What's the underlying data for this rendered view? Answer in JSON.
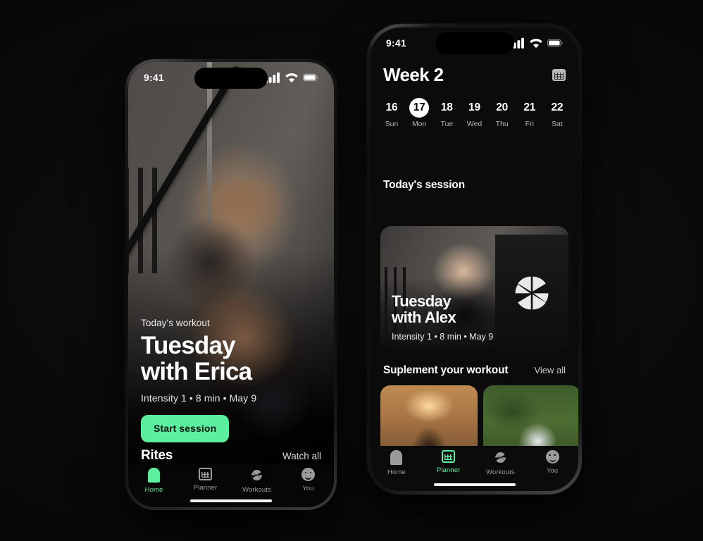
{
  "background_color": "#0a0a0a",
  "accent_color": "#5CEFA0",
  "phone_left": {
    "name": "home-screen",
    "status_bar": {
      "time": "9:41",
      "cellular": "signal-icon",
      "wifi": "wifi-icon",
      "battery": "battery-icon"
    },
    "hero": {
      "eyebrow": "Today's workout",
      "title_line1": "Tuesday",
      "title_line2": "with Erica",
      "meta": "Intensity 1  •  8 min  •  May 9",
      "cta_label": "Start session"
    },
    "rites_section": {
      "title": "Rites",
      "link": "Watch all"
    },
    "tabs": [
      {
        "label": "Home",
        "icon": "home-icon",
        "active": true
      },
      {
        "label": "Planner",
        "icon": "calendar-icon",
        "active": false
      },
      {
        "label": "Workouts",
        "icon": "pinwheel-icon",
        "active": false
      },
      {
        "label": "You",
        "icon": "smiley-face-icon",
        "active": false
      }
    ]
  },
  "phone_right": {
    "name": "planner-screen",
    "status_bar": {
      "time": "9:41",
      "cellular": "signal-icon",
      "wifi": "wifi-icon",
      "battery": "battery-icon"
    },
    "header": {
      "title": "Week 2",
      "calendar_button": "calendar-icon"
    },
    "week_days": [
      {
        "num": "16",
        "name": "Sun",
        "selected": false
      },
      {
        "num": "17",
        "name": "Mon",
        "selected": true
      },
      {
        "num": "18",
        "name": "Tue",
        "selected": false
      },
      {
        "num": "19",
        "name": "Wed",
        "selected": false
      },
      {
        "num": "20",
        "name": "Thu",
        "selected": false
      },
      {
        "num": "21",
        "name": "Fri",
        "selected": false
      },
      {
        "num": "22",
        "name": "Sat",
        "selected": false
      }
    ],
    "today_session": {
      "section_title": "Today's session",
      "title_line1": "Tuesday",
      "title_line2": "with Alex",
      "meta": "Intensity 1  •  8 min  •  May 9",
      "brand_mark": "pinwheel-icon"
    },
    "supplement": {
      "section_title": "Suplement your workout",
      "link": "View all",
      "cards": [
        "meditation-sunset-card",
        "yoga-garden-card",
        "third-card-partial"
      ]
    },
    "tabs": [
      {
        "label": "Home",
        "icon": "home-icon",
        "active": false
      },
      {
        "label": "Planner",
        "icon": "calendar-icon",
        "active": true
      },
      {
        "label": "Workouts",
        "icon": "pinwheel-icon",
        "active": false
      },
      {
        "label": "You",
        "icon": "smiley-face-icon",
        "active": false
      }
    ]
  }
}
